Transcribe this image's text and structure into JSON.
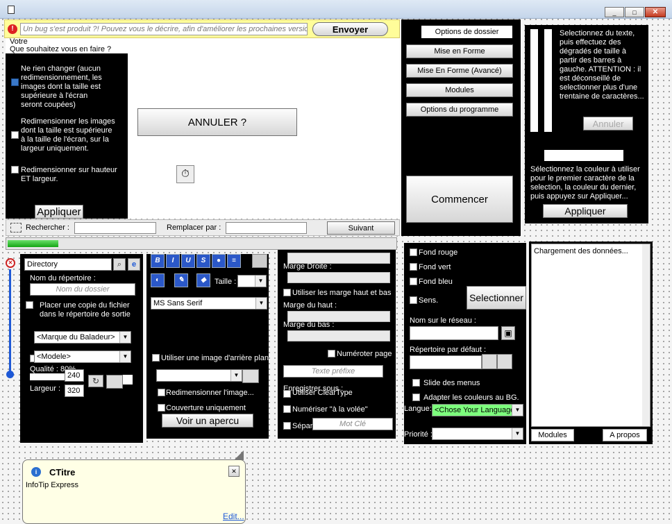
{
  "colors": {
    "accent": "#1d58d6",
    "bug_bar": "#fffd9a",
    "progress": "#22c022",
    "language_bg": "#7dff7d"
  },
  "bug": {
    "message": "Un bug s'est produit ?! Pouvez vous le décrire, afin d'améliorer les prochaines versions",
    "send": "Envoyer"
  },
  "resize": {
    "question": "Votre\nQue souhaitez vous en faire ?",
    "opt1": "Ne rien changer (aucun redimensionnement, les images dont la taille est supérieure à l'écran seront coupées)",
    "opt2": "Redimensionner les images dont la taille est supérieure à la taille de l'écran, sur la largeur uniquement.",
    "opt3": "Redimensionner sur hauteur ET largeur.",
    "apply": "Appliquer",
    "cancel": "ANNULER ?",
    "opt1_checked": true
  },
  "menu": {
    "items": [
      "Options de dossier",
      "Mise en Forme",
      "Mise En Forme (Avancé)",
      "Modules",
      "Options du programme"
    ],
    "start": "Commencer"
  },
  "gradient": {
    "text": "Selectionnez du texte, puis effectuez des dégradés de taille à partir des barres à gauche. ATTENTION : il est déconseillé de selectionner plus d'une trentaine de caractères...",
    "cancel": "Annuler",
    "color_text": "Sélectionnez la couleur à utiliser pour le premier caractère de la selection, la couleur du dernier, puis appuyez sur Appliquer...",
    "apply": "Appliquer"
  },
  "search": {
    "find_label": "Rechercher :",
    "replace_label": "Remplacer par :",
    "next": "Suivant",
    "progress": 0.13
  },
  "dir": {
    "combo": "Directory",
    "name_label": "Nom du répertoire :",
    "name_placeholder": "Nom du dossier",
    "copy_label": "Placer une copie du fichier dans le répertoire de sortie",
    "brand": "<Marque du Baladeur>",
    "model": "<Modele>",
    "quality": "Qualité : 80%",
    "height": "240",
    "width_label": "Largeur :",
    "width": "320"
  },
  "fmt": {
    "size_label": "Taille :",
    "font": "MS Sans Serif",
    "bg_image": "Utiliser une image d'arrière plan",
    "resize_image": "Redimensionner l'image...",
    "cover_only": "Couverture uniquement",
    "preview": "Voir un apercu",
    "tools": [
      "B",
      "I",
      "U",
      "S",
      "●",
      "≡"
    ]
  },
  "margins": {
    "right": "Marge Droite :",
    "use_tb": "Utiliser les marge haut et bas",
    "top": "Marge du haut :",
    "bottom": "Marge du bas :",
    "number_page": "Numéroter page",
    "prefix_placeholder": "Texte préfixe",
    "save_as": "Enregistrer sous :",
    "cleartype": "Utiliser ClearType",
    "numbering": "Numériser \"à la volée\"",
    "separator": "Sépar",
    "keyword_placeholder": "Mot Clé"
  },
  "opts": {
    "red": "Fond rouge",
    "green": "Fond vert",
    "blue": "Fond bleu",
    "sens": "Sens.",
    "select": "Selectionner",
    "network_label": "Nom sur le réseau :",
    "default_dir": "Répertoire par défaut :",
    "slide": "Slide des menus",
    "adapt": "Adapter les couleurs au BG.",
    "lang_label": "Langue:",
    "lang": "<Chose Your Language>",
    "priority_label": "Priorité :"
  },
  "log": {
    "text": "Chargement des données...",
    "tab_modules": "Modules",
    "tab_about": "A propos"
  },
  "tip": {
    "title": "CTitre",
    "body": "InfoTip Express",
    "edit": "Edit..."
  }
}
